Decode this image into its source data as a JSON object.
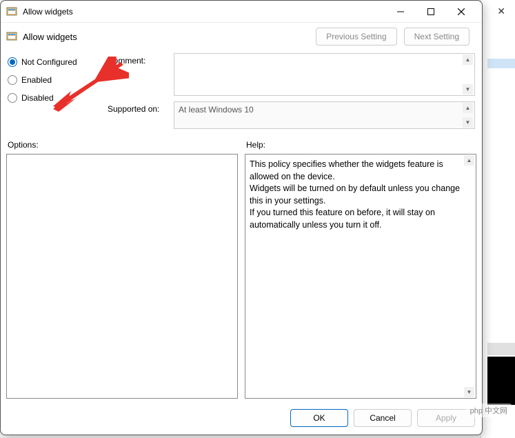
{
  "titlebar": {
    "title": "Allow widgets"
  },
  "subheader": {
    "title": "Allow widgets"
  },
  "nav": {
    "prev": "Previous Setting",
    "next": "Next Setting"
  },
  "radios": {
    "not_configured": "Not Configured",
    "enabled": "Enabled",
    "disabled": "Disabled",
    "selected": "not_configured"
  },
  "form": {
    "comment_label": "Comment:",
    "comment_value": "",
    "supported_label": "Supported on:",
    "supported_value": "At least Windows 10"
  },
  "panels": {
    "options_label": "Options:",
    "options_value": "",
    "help_label": "Help:",
    "help_value": "This policy specifies whether the widgets feature is allowed on the device.\nWidgets will be turned on by default unless you change this in your settings.\nIf you turned this feature on before, it will stay on automatically unless you turn it off."
  },
  "footer": {
    "ok": "OK",
    "cancel": "Cancel",
    "apply": "Apply"
  },
  "watermark": "php 中文网"
}
